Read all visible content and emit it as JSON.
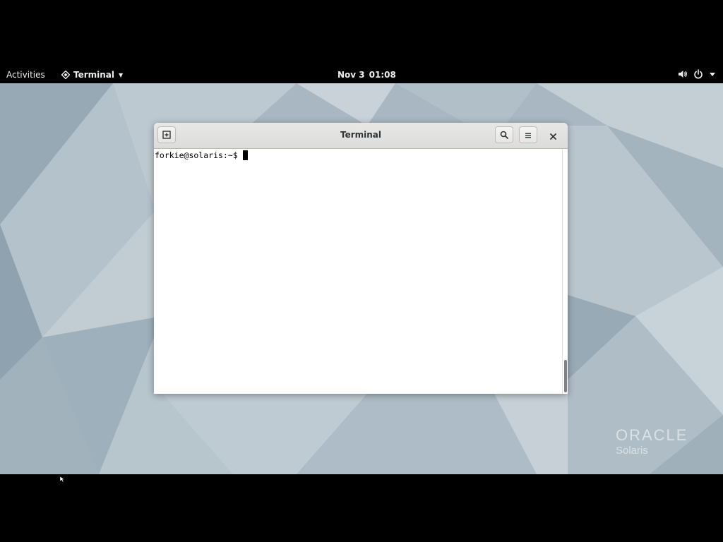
{
  "topbar": {
    "activities_label": "Activities",
    "app_menu_label": "Terminal",
    "app_menu_icon": "terminal-app-icon",
    "clock_date": "Nov 3",
    "clock_time": "01:08",
    "status_icons": [
      "volume-icon",
      "power-icon",
      "chevron-down-icon"
    ]
  },
  "desktop": {
    "logo_line1": "ORACLE",
    "logo_line2": "Solaris"
  },
  "window": {
    "title": "Terminal",
    "new_tab_icon": "new-tab-icon",
    "search_icon": "search-icon",
    "menu_icon": "hamburger-menu-icon",
    "close_icon": "close-icon",
    "prompt": "forkie@solaris:~$"
  },
  "colors": {
    "topbar_bg": "#000000",
    "desktop_bg": "#a9b8c2",
    "headerbar_bg": "#e0e0df",
    "terminal_bg": "#ffffff",
    "terminal_fg": "#000000"
  }
}
